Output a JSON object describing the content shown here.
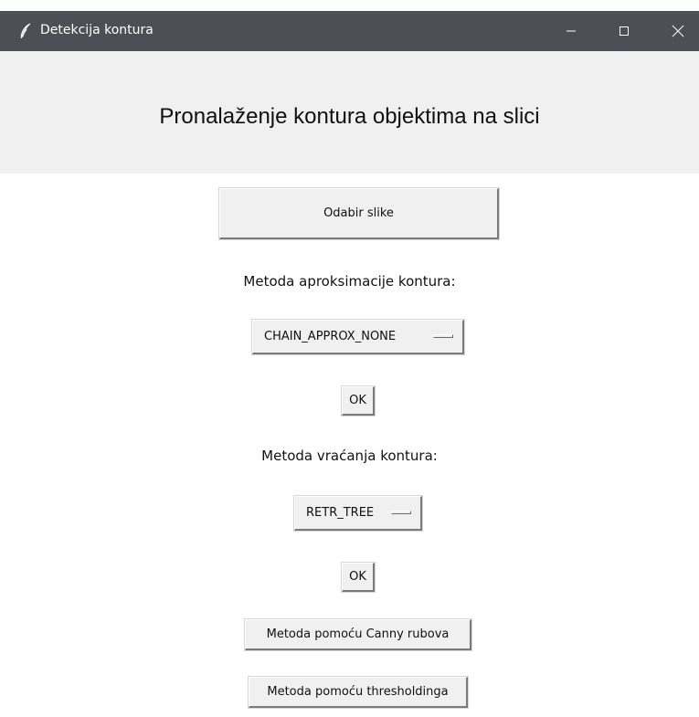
{
  "window": {
    "title": "Detekcija kontura",
    "controls": {
      "minimize": "minimize-icon",
      "maximize": "maximize-icon",
      "close": "close-icon"
    },
    "app_icon": "feather-icon"
  },
  "header": {
    "title": "Pronalaženje kontura objektima na slici"
  },
  "buttons": {
    "select_image": "Odabir slike",
    "ok_approx": "OK",
    "ok_retr": "OK",
    "canny": "Metoda pomoću Canny rubova",
    "threshold": "Metoda pomoću thresholdinga"
  },
  "approx": {
    "label": "Metoda aproksimacije kontura:",
    "selected": "CHAIN_APPROX_NONE"
  },
  "retrieval": {
    "label": "Metoda vraćanja kontura:",
    "selected": "RETR_TREE"
  },
  "colors": {
    "titlebar": "#4c4f55",
    "header_bg": "#f0f0f0",
    "body_bg": "#ffffff"
  }
}
